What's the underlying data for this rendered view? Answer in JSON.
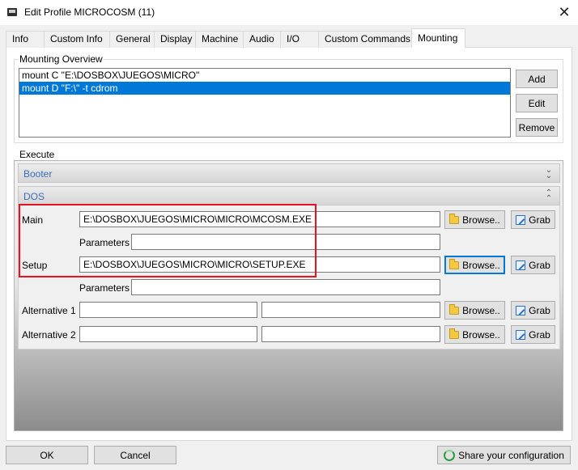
{
  "window": {
    "title": "Edit Profile MICROCOSM (11)"
  },
  "tabs": [
    {
      "label": "Info",
      "active": false
    },
    {
      "label": "Custom Info",
      "active": false
    },
    {
      "label": "General",
      "active": false
    },
    {
      "label": "Display",
      "active": false
    },
    {
      "label": "Machine",
      "active": false
    },
    {
      "label": "Audio",
      "active": false
    },
    {
      "label": "I/O",
      "active": false
    },
    {
      "label": "Custom Commands",
      "active": false
    },
    {
      "label": "Mounting",
      "active": true
    }
  ],
  "mounting": {
    "group_label": "Mounting Overview",
    "items": [
      {
        "text": "mount C \"E:\\DOSBOX\\JUEGOS\\MICRO\"",
        "selected": false
      },
      {
        "text": "mount D \"F:\\\" -t cdrom",
        "selected": true
      }
    ],
    "add_label": "Add",
    "edit_label": "Edit",
    "remove_label": "Remove"
  },
  "execute": {
    "group_label": "Execute",
    "booter_label": "Booter",
    "dos_label": "DOS",
    "main_label": "Main",
    "main_value": "E:\\DOSBOX\\JUEGOS\\MICRO\\MICRO\\MCOSM.EXE",
    "main_params_label": "Parameters",
    "main_params_value": "",
    "setup_label": "Setup",
    "setup_value": "E:\\DOSBOX\\JUEGOS\\MICRO\\MICRO\\SETUP.EXE",
    "setup_params_label": "Parameters",
    "setup_params_value": "",
    "alt1_label": "Alternative 1",
    "alt1_value": "",
    "alt1_params_value": "",
    "alt2_label": "Alternative 2",
    "alt2_value": "",
    "alt2_params_value": "",
    "browse_label": "Browse..",
    "grab_label": "Grab"
  },
  "footer": {
    "ok_label": "OK",
    "cancel_label": "Cancel",
    "share_label": "Share your configuration"
  },
  "colors": {
    "selection": "#0078d7",
    "section_title": "#3a6fb7",
    "highlight": "#e81123"
  },
  "icons": {
    "close": "close-icon",
    "browse": "folder-icon",
    "grab": "grab-icon",
    "share": "share-icon"
  }
}
